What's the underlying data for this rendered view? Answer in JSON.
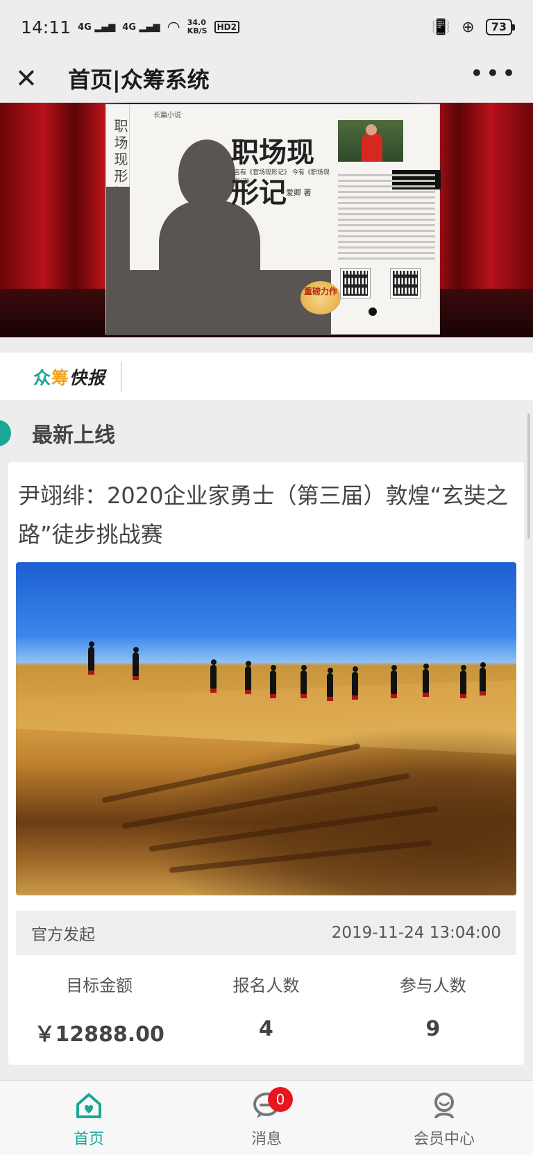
{
  "status_bar": {
    "time": "14:11",
    "signal1": "4G",
    "signal2": "4G",
    "net_speed": "34.0",
    "net_unit": "KB/S",
    "hd": "HD2",
    "battery": "73"
  },
  "nav": {
    "title": "首页|众筹系统",
    "close_icon": "close-icon",
    "more_icon": "more-icon"
  },
  "banner": {
    "book_label": "长篇小说",
    "book_title": "职场现形记",
    "book_spine": "职场现形记",
    "book_subtitle": "吉有《官场现形记》 今有《职场现形记》",
    "book_author": "爱卿 著",
    "seal_text": "重磅力作"
  },
  "ticker": {
    "logo_part1": "众",
    "logo_part2": "筹",
    "logo_part3": "快报"
  },
  "section": {
    "title": "最新上线"
  },
  "project": {
    "title": "尹翊绯：2020企业家勇士（第三届）敦煌“玄奘之路”徒步挑战赛",
    "initiator": "官方发起",
    "datetime": "2019-11-24 13:04:00",
    "stats": [
      {
        "label": "目标金额",
        "value": "￥12888.00"
      },
      {
        "label": "报名人数",
        "value": "4"
      },
      {
        "label": "参与人数",
        "value": "9"
      }
    ]
  },
  "tabbar": {
    "items": [
      {
        "label": "首页",
        "icon": "home-icon",
        "active": true
      },
      {
        "label": "消息",
        "icon": "message-icon",
        "active": false
      },
      {
        "label": "会员中心",
        "icon": "user-icon",
        "active": false
      }
    ],
    "message_badge": "0"
  },
  "colors": {
    "accent": "#1aa795",
    "accent_secondary": "#f0a51c",
    "badge": "#e8161e"
  }
}
